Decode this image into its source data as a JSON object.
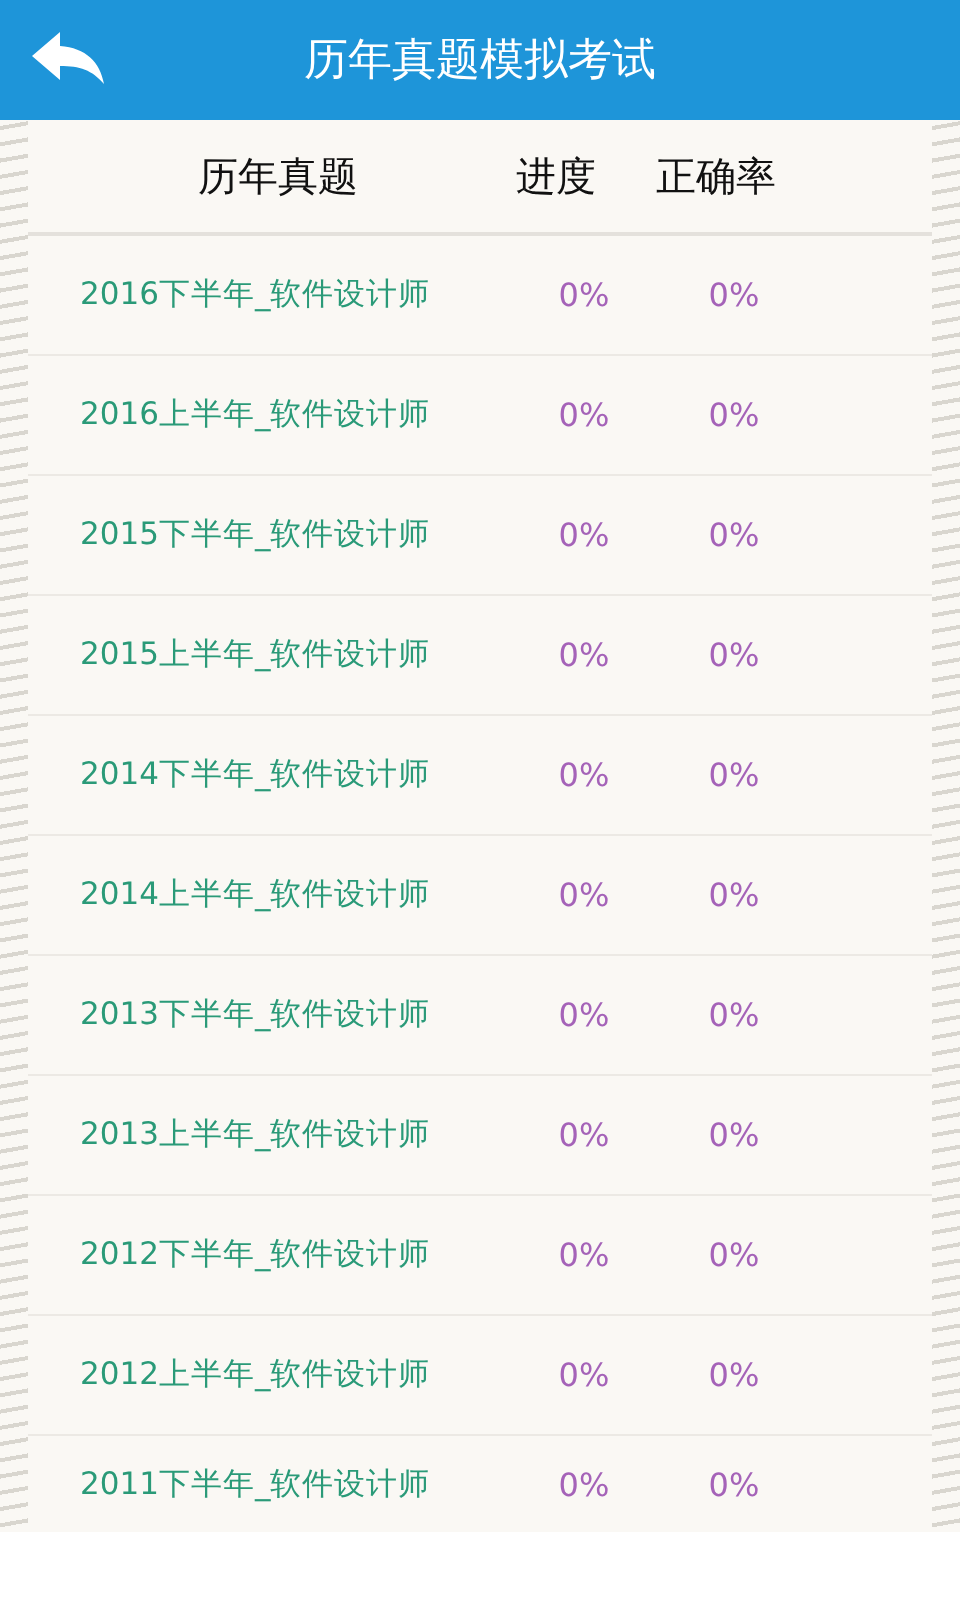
{
  "app_bar": {
    "title": "历年真题模拟考试"
  },
  "table": {
    "columns": [
      "历年真题",
      "进度",
      "正确率"
    ],
    "rows": [
      {
        "name": "2016下半年_软件设计师",
        "progress": "0%",
        "accuracy": "0%"
      },
      {
        "name": "2016上半年_软件设计师",
        "progress": "0%",
        "accuracy": "0%"
      },
      {
        "name": "2015下半年_软件设计师",
        "progress": "0%",
        "accuracy": "0%"
      },
      {
        "name": "2015上半年_软件设计师",
        "progress": "0%",
        "accuracy": "0%"
      },
      {
        "name": "2014下半年_软件设计师",
        "progress": "0%",
        "accuracy": "0%"
      },
      {
        "name": "2014上半年_软件设计师",
        "progress": "0%",
        "accuracy": "0%"
      },
      {
        "name": "2013下半年_软件设计师",
        "progress": "0%",
        "accuracy": "0%"
      },
      {
        "name": "2013上半年_软件设计师",
        "progress": "0%",
        "accuracy": "0%"
      },
      {
        "name": "2012下半年_软件设计师",
        "progress": "0%",
        "accuracy": "0%"
      },
      {
        "name": "2012上半年_软件设计师",
        "progress": "0%",
        "accuracy": "0%"
      },
      {
        "name": "2011下半年_软件设计师",
        "progress": "0%",
        "accuracy": "0%"
      }
    ]
  }
}
